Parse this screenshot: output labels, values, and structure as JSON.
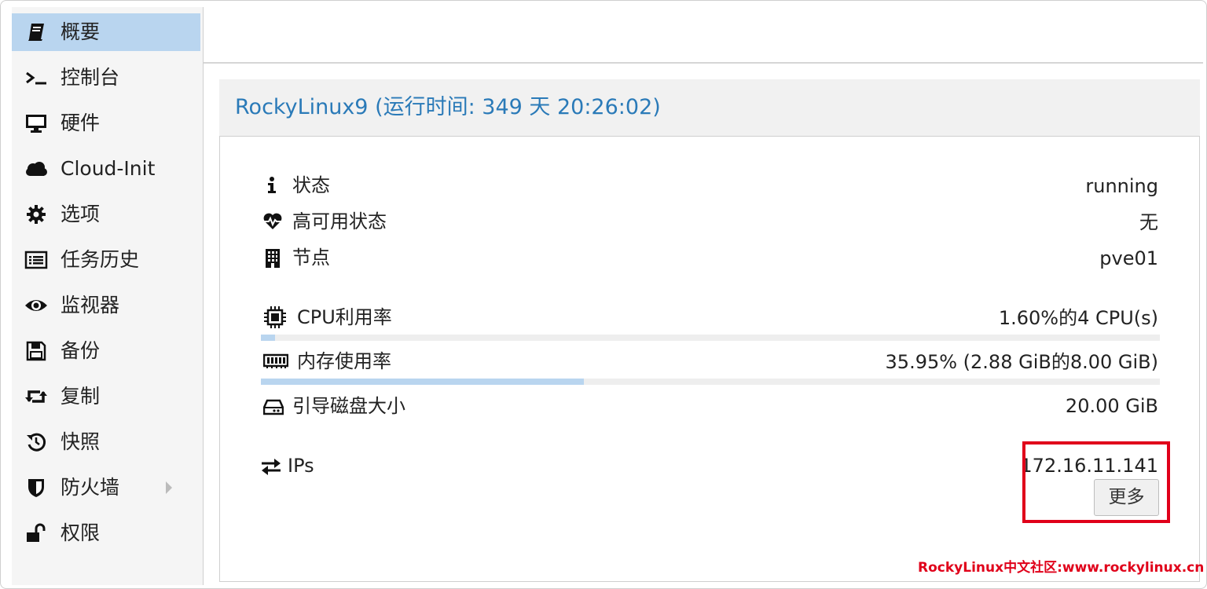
{
  "sidebar": {
    "items": [
      {
        "label": "概要",
        "icon": "book-icon",
        "active": true
      },
      {
        "label": "控制台",
        "icon": "terminal-icon"
      },
      {
        "label": "硬件",
        "icon": "monitor-icon"
      },
      {
        "label": "Cloud-Init",
        "icon": "cloud-icon"
      },
      {
        "label": "选项",
        "icon": "gear-icon"
      },
      {
        "label": "任务历史",
        "icon": "list-icon"
      },
      {
        "label": "监视器",
        "icon": "eye-icon"
      },
      {
        "label": "备份",
        "icon": "floppy-icon"
      },
      {
        "label": "复制",
        "icon": "retweet-icon"
      },
      {
        "label": "快照",
        "icon": "history-icon"
      },
      {
        "label": "防火墙",
        "icon": "shield-icon"
      },
      {
        "label": "权限",
        "icon": "unlock-icon"
      }
    ]
  },
  "panel": {
    "title": "RockyLinux9 (运行时间: 349 天 20:26:02)"
  },
  "status": {
    "state_label": "状态",
    "state_value": "running",
    "ha_label": "高可用状态",
    "ha_value": "无",
    "node_label": "节点",
    "node_value": "pve01"
  },
  "usage": {
    "cpu_label": "CPU利用率",
    "cpu_value": "1.60%的4 CPU(s)",
    "cpu_fraction": 0.016,
    "mem_label": "内存使用率",
    "mem_value": "35.95% (2.88 GiB的8.00 GiB)",
    "mem_fraction": 0.3595,
    "disk_label": "引导磁盘大小",
    "disk_value": "20.00 GiB"
  },
  "network": {
    "ips_label": "IPs",
    "ip_value": "172.16.11.141",
    "more_label": "更多"
  },
  "watermark": "RockyLinux中文社区:www.rockylinux.cn",
  "colors": {
    "accent": "#2a7ab8",
    "active_bg": "#b9d5ef",
    "highlight": "#e0001a"
  }
}
